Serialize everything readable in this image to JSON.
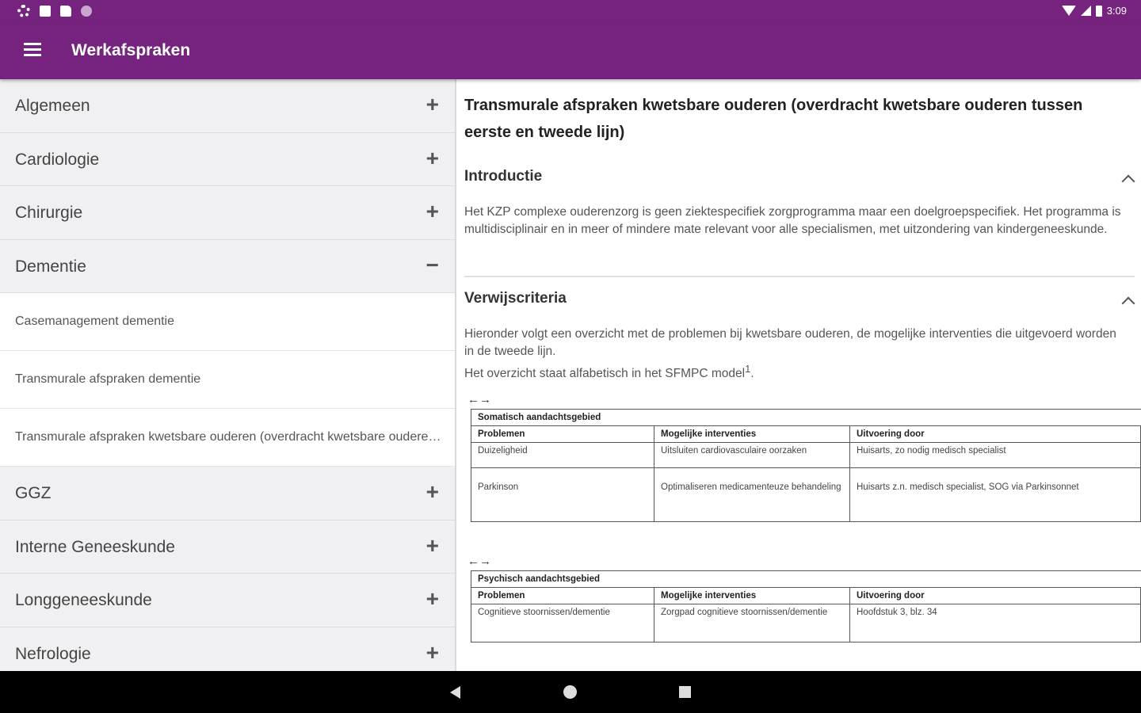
{
  "status_bar": {
    "time": "3:09"
  },
  "app_bar": {
    "title": "Werkafspraken"
  },
  "sidebar": {
    "categories_top": [
      {
        "label": "Algemeen",
        "toggle": "+"
      },
      {
        "label": "Cardiologie",
        "toggle": "+"
      },
      {
        "label": "Chirurgie",
        "toggle": "+"
      },
      {
        "label": "Dementie",
        "toggle": "−"
      }
    ],
    "subitems": [
      {
        "label": "Casemanagement dementie"
      },
      {
        "label": "Transmurale afspraken dementie"
      },
      {
        "label": "Transmurale afspraken kwetsbare ouderen (overdracht kwetsbare ouderen tussen eerste en tweede lijn)"
      }
    ],
    "categories_bottom": [
      {
        "label": "GGZ",
        "toggle": "+"
      },
      {
        "label": "Interne Geneeskunde",
        "toggle": "+"
      },
      {
        "label": "Longgeneeskunde",
        "toggle": "+"
      },
      {
        "label": "Nefrologie",
        "toggle": "+"
      }
    ]
  },
  "content": {
    "title": "Transmurale afspraken kwetsbare ouderen (overdracht kwetsbare ouderen tussen eerste en tweede lijn)",
    "intro": {
      "heading": "Introductie",
      "text": "Het KZP complexe ouderenzorg is geen ziektespecifiek zorgprogramma  maar een doelgroepspecifiek. Het programma is multidisciplinair en  in meer of mindere mate relevant voor alle specialismen, met uitzondering van kindergeneeskunde."
    },
    "criteria": {
      "heading": "Verwijscriteria",
      "line1": "Hieronder volgt een overzicht met de problemen bij kwetsbare ouderen, de mogelijke interventies die uitgevoerd worden in de tweede lijn.",
      "line2": "Het overzicht staat alfabetisch in het SFMPC model",
      "footnote": "1"
    },
    "scroll_hint": "←→",
    "table1": {
      "area": "Somatisch aandachtsgebied",
      "headers": [
        "Problemen",
        "Mogelijke interventies",
        "Uitvoering door"
      ],
      "rows": [
        [
          "Duizeligheid",
          "Uitsluiten cardiovasculaire oorzaken",
          "Huisarts, zo nodig medisch specialist"
        ],
        [
          "Parkinson",
          "Optimaliseren medicamenteuze behandeling",
          "Huisarts z.n. medisch specialist, SOG via Parkinsonnet"
        ]
      ]
    },
    "table2": {
      "area": "Psychisch aandachtsgebied",
      "headers": [
        "Problemen",
        "Mogelijke interventies",
        "Uitvoering door"
      ],
      "rows": [
        [
          "Cognitieve stoornissen/dementie",
          "Zorgpad cognitieve stoornissen/dementie",
          "Hoofdstuk 3, blz. 34"
        ]
      ]
    }
  }
}
